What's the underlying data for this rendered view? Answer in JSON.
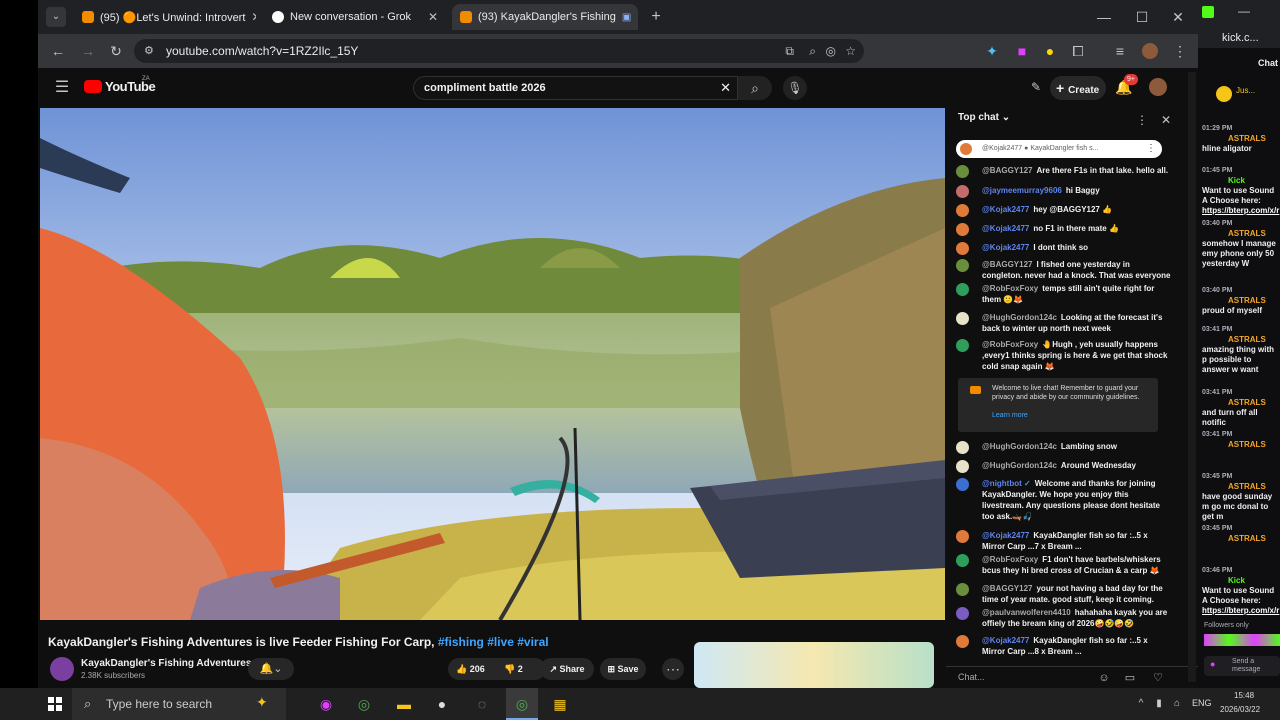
{
  "browser": {
    "tabs": [
      {
        "label": "(95) 🟠Let's Unwind: Introvert",
        "color": "#f28b00"
      },
      {
        "label": "New conversation - Grok",
        "color": "#ffffff"
      },
      {
        "label": "(93) KayakDangler's Fishing",
        "color": "#f28b00"
      }
    ],
    "url": "youtube.com/watch?v=1RZ2Ilc_15Y"
  },
  "youtube": {
    "logo": "YouTube",
    "region": "ZA",
    "search_value": "compliment battle 2026",
    "create_label": "Create",
    "notif_count": "9+",
    "video_title": "KayakDangler's Fishing Adventures is live Feeder Fishing For Carp,",
    "hashtags": "#fishing #live #viral",
    "channel_name": "KayakDangler's Fishing Adventures",
    "subscribers": "2.38K subscribers",
    "likes": "206",
    "dislikes": "2",
    "share_label": "Share",
    "save_label": "Save"
  },
  "chat": {
    "header": "Top chat",
    "pinned": {
      "author": "@Kojak2477",
      "text": "KayakDangler fish s..."
    },
    "messages": [
      {
        "author": "@BAGGY127",
        "text": "Are there F1s in that lake. hello all.",
        "color": "#6a8f3c",
        "blue": false
      },
      {
        "author": "@jaymeemurray9606",
        "text": "hi Baggy",
        "color": "#c46b6b",
        "blue": true
      },
      {
        "author": "@Kojak2477",
        "text": "hey @BAGGY127 👍",
        "color": "#e07a3a",
        "blue": true
      },
      {
        "author": "@Kojak2477",
        "text": "no F1 in there mate 👍",
        "color": "#e07a3a",
        "blue": true
      },
      {
        "author": "@Kojak2477",
        "text": "I dont think so",
        "color": "#e07a3a",
        "blue": true
      },
      {
        "author": "@BAGGY127",
        "text": "I fished one yesterday in congleton. never had a knock. That was everyone",
        "color": "#6a8f3c",
        "blue": false
      },
      {
        "author": "@RobFoxFoxy",
        "text": "temps still ain't quite right for them 🙂🦊",
        "color": "#2f9e5c",
        "blue": false
      },
      {
        "author": "@HughGordon124c",
        "text": "Looking at the forecast it's back to winter up north next week",
        "color": "#e8e2c8",
        "blue": false
      },
      {
        "author": "@RobFoxFoxy",
        "text": "🤚Hugh , yeh usually happens ,every1 thinks spring is here & we get that shock cold snap again 🦊",
        "color": "#2f9e5c",
        "blue": false
      }
    ],
    "notice": "Welcome to live chat! Remember to guard your privacy and abide by our community guidelines.",
    "learn_more": "Learn more",
    "messages2": [
      {
        "author": "@HughGordon124c",
        "text": "Lambing snow",
        "color": "#e8e2c8",
        "blue": false
      },
      {
        "author": "@HughGordon124c",
        "text": "Around Wednesday",
        "color": "#e8e2c8",
        "blue": false
      },
      {
        "author": "@nightbot ✓",
        "text": "Welcome and thanks for joining KayakDangler. We hope you enjoy this livestream. Any questions please dont hesitate too ask.🛶🎣",
        "color": "#3b6fd1",
        "blue": true
      },
      {
        "author": "@Kojak2477",
        "text": "KayakDangler fish so far :..5 x Mirror Carp ...7 x Bream ...",
        "color": "#e07a3a",
        "blue": true
      },
      {
        "author": "@RobFoxFoxy",
        "text": "F1 don't have barbels/whiskers bcus they hi bred cross of Crucian & a carp 🦊",
        "color": "#2f9e5c",
        "blue": false
      },
      {
        "author": "@BAGGY127",
        "text": "your not having a bad day for the time of year mate. good stuff, keep it coming.",
        "color": "#6a8f3c",
        "blue": false
      },
      {
        "author": "@paulvanwolferen4410",
        "text": "hahahaha kayak you are offiely the bream king of 2026🤪🤣🤪🤣",
        "color": "#7a5cc2",
        "blue": false
      },
      {
        "author": "@Kojak2477",
        "text": "KayakDangler fish so far :..5 x Mirror Carp ...8 x Bream ...",
        "color": "#e07a3a",
        "blue": true
      }
    ],
    "input_placeholder": "Chat..."
  },
  "kick": {
    "tab_label": "kick.c...",
    "header": "Chat",
    "badge_label": "Jus...",
    "messages": [
      {
        "time": "01:29 PM",
        "user": "ASTRALS",
        "text": "hline aligator",
        "link": ""
      },
      {
        "time": "01:45 PM",
        "user": "Kick",
        "text": "Want to use Sound A Choose here:",
        "link": "https://bterp.com/x/r"
      },
      {
        "time": "03:40 PM",
        "user": "ASTRALS",
        "text": "somehow I manage emy phone only 50 yesterday W",
        "link": ""
      },
      {
        "time": "03:40 PM",
        "user": "ASTRALS",
        "text": "proud of myself",
        "link": ""
      },
      {
        "time": "03:41 PM",
        "user": "ASTRALS",
        "text": "amazing thing with p possible to answer w want",
        "link": ""
      },
      {
        "time": "03:41 PM",
        "user": "ASTRALS",
        "text": "and turn off all notific",
        "link": ""
      },
      {
        "time": "03:41 PM",
        "user": "ASTRALS",
        "text": "",
        "link": ""
      },
      {
        "time": "03:45 PM",
        "user": "ASTRALS",
        "text": "have good sunday m go mc donal to get m",
        "link": ""
      },
      {
        "time": "03:45 PM",
        "user": "ASTRALS",
        "text": "",
        "link": ""
      },
      {
        "time": "03:46 PM",
        "user": "Kick",
        "text": "Want to use Sound A Choose here:",
        "link": "https://bterp.com/x/r"
      }
    ],
    "followers_only": "Followers only",
    "send_placeholder": "Send a message"
  },
  "taskbar": {
    "search_placeholder": "Type here to search",
    "lang": "ENG",
    "time": "15:48",
    "date": "2026/03/22"
  }
}
